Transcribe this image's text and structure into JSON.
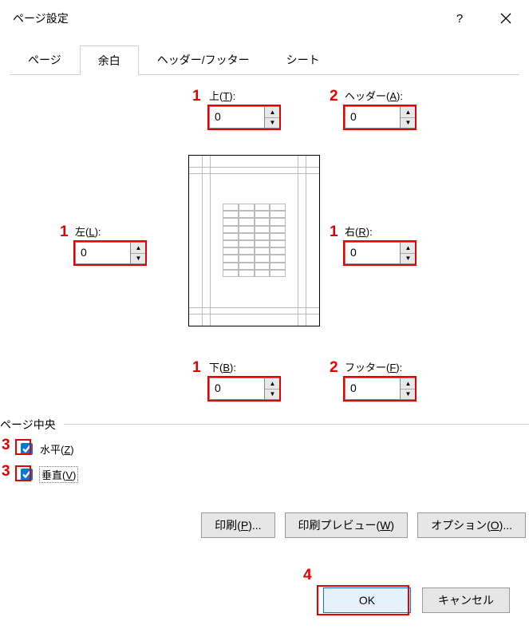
{
  "title": "ページ設定",
  "tabs": [
    "ページ",
    "余白",
    "ヘッダー/フッター",
    "シート"
  ],
  "active_tab": 1,
  "fields": {
    "top": {
      "label_pre": "上(",
      "hotkey": "T",
      "label_post": "):",
      "value": "0"
    },
    "header": {
      "label_pre": "ヘッダー(",
      "hotkey": "A",
      "label_post": "):",
      "value": "0"
    },
    "left": {
      "label_pre": "左(",
      "hotkey": "L",
      "label_post": "):",
      "value": "0"
    },
    "right": {
      "label_pre": "右(",
      "hotkey": "R",
      "label_post": "):",
      "value": "0"
    },
    "bottom": {
      "label_pre": "下(",
      "hotkey": "B",
      "label_post": "):",
      "value": "0"
    },
    "footer": {
      "label_pre": "フッター(",
      "hotkey": "F",
      "label_post": "):",
      "value": "0"
    }
  },
  "center_section": "ページ中央",
  "checkboxes": {
    "horizontal": {
      "label_pre": "水平(",
      "hotkey": "Z",
      "label_post": ")",
      "checked": true
    },
    "vertical": {
      "label_pre": "垂直(",
      "hotkey": "V",
      "label_post": ")",
      "checked": true
    }
  },
  "buttons": {
    "print": {
      "pre": "印刷(",
      "hotkey": "P",
      "post": ")..."
    },
    "print_preview": {
      "pre": "印刷プレビュー(",
      "hotkey": "W",
      "post": ")"
    },
    "options": {
      "pre": "オプション(",
      "hotkey": "O",
      "post": ")..."
    },
    "ok": "OK",
    "cancel": "キャンセル"
  },
  "annotations": {
    "a1": "1",
    "a2": "2",
    "a3": "3",
    "a4": "4"
  }
}
